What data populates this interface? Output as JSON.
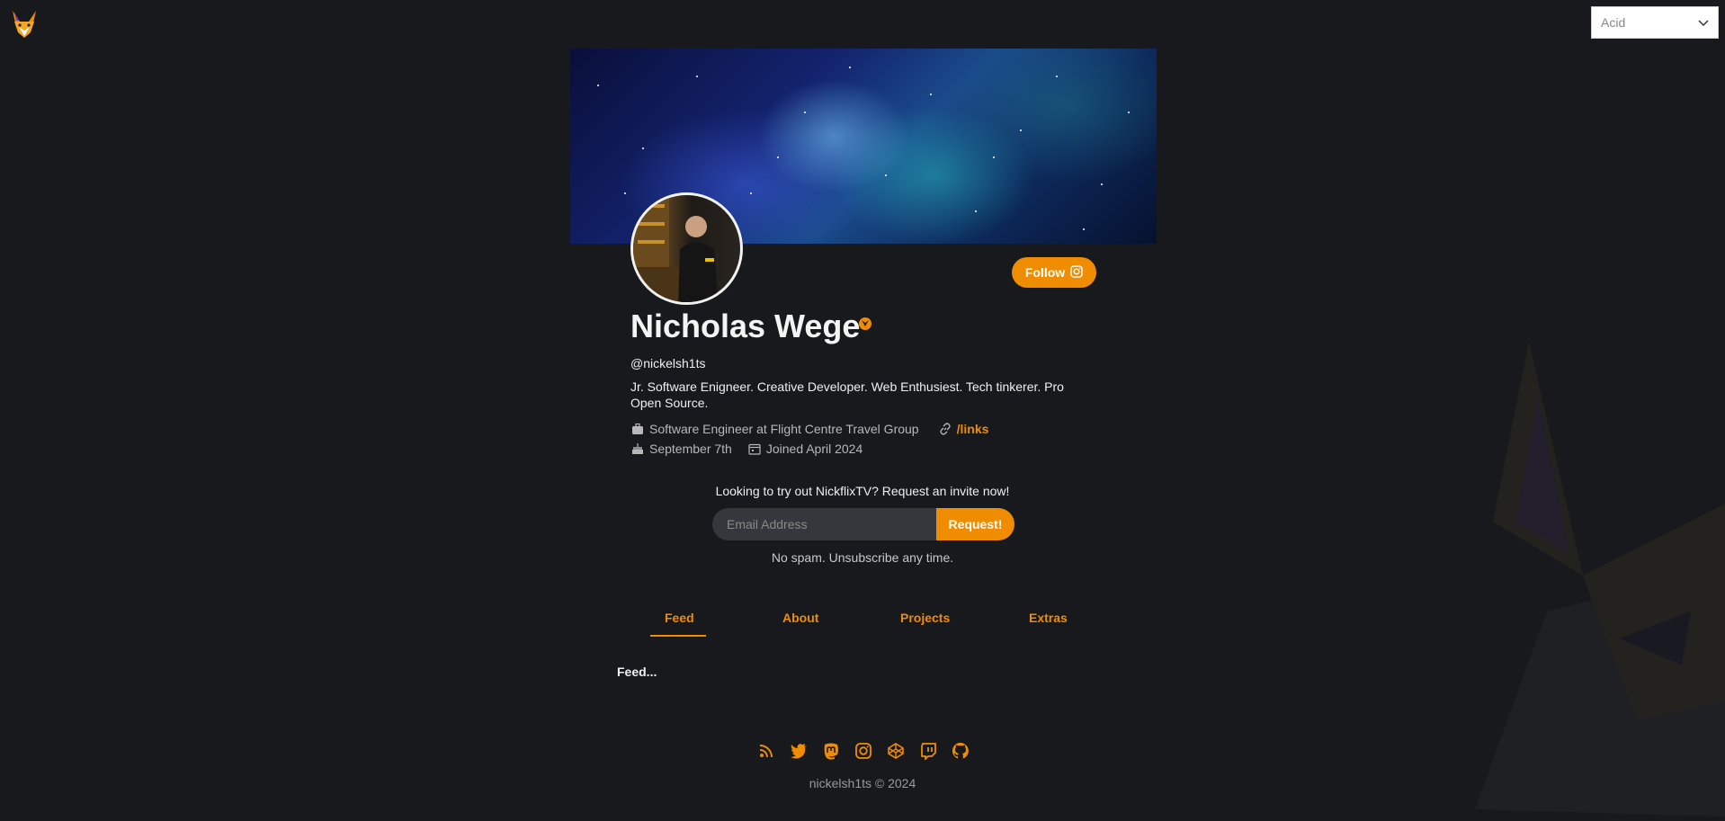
{
  "theme_select": {
    "selected": "Acid"
  },
  "profile": {
    "name": "Nicholas Wege",
    "handle": "@nickelsh1ts",
    "bio": "Jr. Software Enigneer. Creative Developer. Web Enthusiest. Tech tinkerer. Pro Open Source.",
    "follow_label": "Follow",
    "job": "Software Engineer at Flight Centre Travel Group",
    "links_label": "/links",
    "birthday": "September 7th",
    "joined": "Joined April 2024"
  },
  "invite": {
    "title": "Looking to try out NickflixTV? Request an invite now!",
    "email_placeholder": "Email Address",
    "button_label": "Request!",
    "note": "No spam. Unsubscribe any time."
  },
  "tabs": [
    {
      "label": "Feed",
      "active": true
    },
    {
      "label": "About"
    },
    {
      "label": "Projects"
    },
    {
      "label": "Extras"
    }
  ],
  "feed": {
    "text": "Feed..."
  },
  "social_icons": [
    "rss-icon",
    "twitter-icon",
    "mastodon-icon",
    "instagram-icon",
    "codepen-icon",
    "twitch-icon",
    "github-icon"
  ],
  "footer": {
    "text": "nickelsh1ts © 2024"
  },
  "colors": {
    "accent": "#f08c00",
    "background": "#17191d"
  }
}
